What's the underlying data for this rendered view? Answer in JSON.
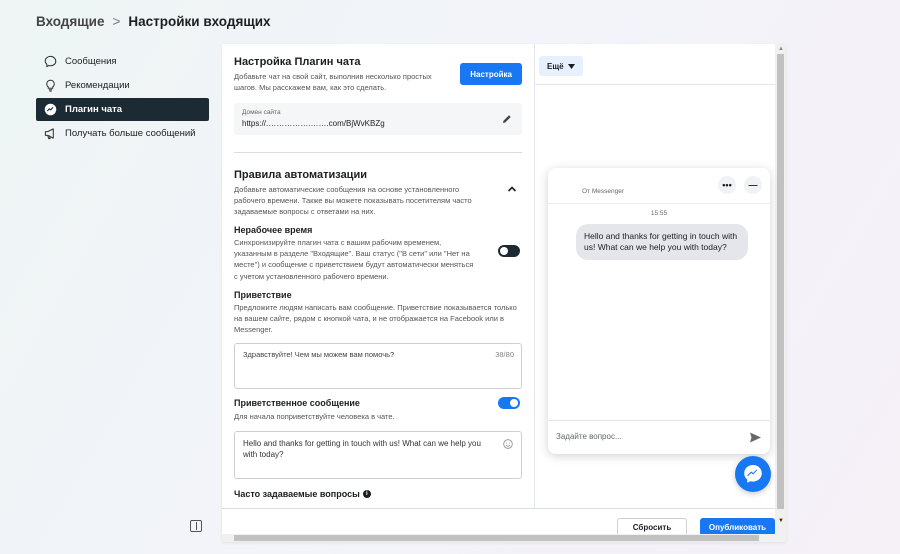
{
  "breadcrumb": {
    "root": "Входящие",
    "separator": ">",
    "current": "Настройки входящих"
  },
  "sidebar": {
    "items": [
      {
        "label": "Сообщения",
        "icon": "chat-bubble-icon"
      },
      {
        "label": "Рекомендации",
        "icon": "lightbulb-icon"
      },
      {
        "label": "Плагин чата",
        "icon": "messenger-icon",
        "active": true
      },
      {
        "label": "Получать больше сообщений",
        "icon": "megaphone-icon"
      }
    ]
  },
  "setup": {
    "title": "Настройка Плагин чата",
    "desc": "Добавьте чат на свой сайт, выполнив несколько простых шагов. Мы расскажем вам, как это сделать.",
    "button": "Настройка",
    "domain_label": "Домен сайта",
    "domain_value": "https://.…………….…….com/BjWvKBZg"
  },
  "automation": {
    "title": "Правила автоматизации",
    "desc": "Добавьте автоматические сообщения на основе установленного рабочего времени. Также вы можете показывать посетителям часто задаваемые вопросы с ответами на них.",
    "offhours": {
      "title": "Нерабочее время",
      "desc": "Синхронизируйте плагин чата с вашим рабочим временем, указанным в разделе \"Входящие\". Ваш статус (\"В сети\" или \"Нет на месте\") и сообщение с приветствием будут автоматически меняться с учетом установленного рабочего времени.",
      "enabled": false
    },
    "greeting": {
      "title": "Приветствие",
      "desc": "Предложите людям написать вам сообщение. Приветствие показывается только на вашем сайте, рядом с кнопкой чата, и не отображается на Facebook или в Messenger.",
      "text": "Здравствуйте! Чем мы можем вам помочь?",
      "count": "38/80"
    },
    "welcome": {
      "title": "Приветственное сообщение",
      "desc": "Для начала поприветствуйте человека в чате.",
      "enabled": true,
      "text": "Hello and thanks for getting in touch with us! What can we help you with today?"
    },
    "faq_title": "Часто задаваемые вопросы",
    "faq_info": "i"
  },
  "preview": {
    "more_button": "Ещё",
    "from": "От Messenger",
    "more_dots": "•••",
    "minimize": "—",
    "time": "15:55",
    "message": "Hello and thanks for getting in touch with us! What can we help you with today?",
    "input_placeholder": "Задайте вопрос..."
  },
  "footer": {
    "reset": "Сбросить",
    "publish": "Опубликовать"
  },
  "colors": {
    "primary": "#1877f2",
    "active_nav": "#1c2b33"
  }
}
